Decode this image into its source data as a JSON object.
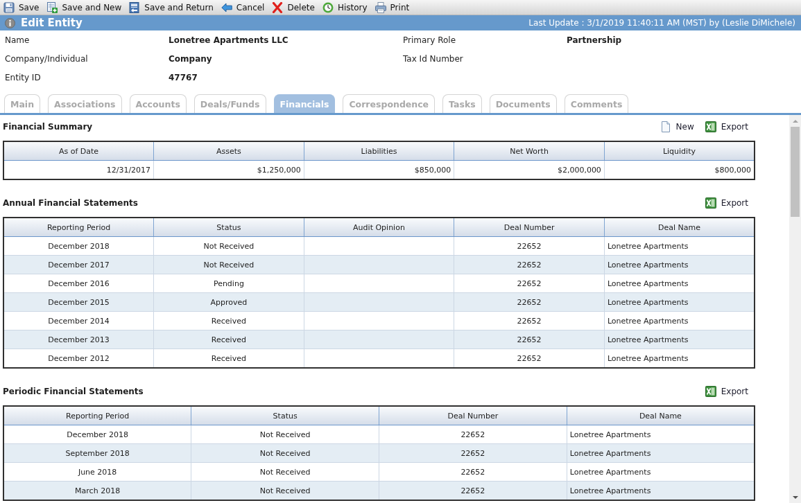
{
  "toolbar": [
    {
      "kind": "save",
      "label": "Save"
    },
    {
      "kind": "savenew",
      "label": "Save and New"
    },
    {
      "kind": "savereturn",
      "label": "Save and Return"
    },
    {
      "kind": "cancel",
      "label": "Cancel"
    },
    {
      "kind": "delete",
      "label": "Delete"
    },
    {
      "kind": "history",
      "label": "History"
    },
    {
      "kind": "print",
      "label": "Print"
    }
  ],
  "header": {
    "title": "Edit Entity",
    "last_update": "Last Update : 3/1/2019 11:40:11 AM (MST) by (Leslie DiMichele)"
  },
  "fields": [
    {
      "label": "Name",
      "value": "Lonetree Apartments LLC"
    },
    {
      "label": "Primary Role",
      "value": "Partnership"
    },
    {
      "label": "Company/Individual",
      "value": "Company"
    },
    {
      "label": "Tax Id Number"
    },
    {
      "label": "Entity ID",
      "value": "47767"
    }
  ],
  "tabs": [
    {
      "label": "Main",
      "selected": false
    },
    {
      "label": "Associations",
      "selected": false
    },
    {
      "label": "Accounts",
      "selected": false
    },
    {
      "label": "Deals/Funds",
      "selected": false
    },
    {
      "label": "Financials",
      "selected": true
    },
    {
      "label": "Correspondence",
      "selected": false
    },
    {
      "label": "Tasks",
      "selected": false
    },
    {
      "label": "Documents",
      "selected": false
    },
    {
      "label": "Comments",
      "selected": false
    }
  ],
  "sections": [
    {
      "kind": "summary",
      "title": "Financial Summary",
      "actions": [
        {
          "kind": "new",
          "label": "New"
        },
        {
          "kind": "export",
          "label": "Export"
        }
      ],
      "table": {
        "columns": [
          "As of Date",
          "Assets",
          "Liabilities",
          "Net Worth",
          "Liquidity"
        ],
        "rows": [
          [
            "12/31/2017",
            "$1,250,000",
            "$850,000",
            "$2,000,000",
            "$800,000"
          ]
        ]
      }
    },
    {
      "kind": "list",
      "title": "Annual Financial Statements",
      "actions": [
        {
          "kind": "export",
          "label": "Export"
        }
      ],
      "table": {
        "columns": [
          "Reporting Period",
          "Status",
          "Audit Opinion",
          "Deal Number",
          "Deal Name"
        ],
        "rows": [
          [
            "December 2018",
            "Not Received",
            null,
            "22652",
            "Lonetree Apartments"
          ],
          [
            "December 2017",
            "Not Received",
            null,
            "22652",
            "Lonetree Apartments"
          ],
          [
            "December 2016",
            "Pending",
            null,
            "22652",
            "Lonetree Apartments"
          ],
          [
            "December 2015",
            "Approved",
            null,
            "22652",
            "Lonetree Apartments"
          ],
          [
            "December 2014",
            "Received",
            null,
            "22652",
            "Lonetree Apartments"
          ],
          [
            "December 2013",
            "Received",
            null,
            "22652",
            "Lonetree Apartments"
          ],
          [
            "December 2012",
            "Received",
            null,
            "22652",
            "Lonetree Apartments"
          ]
        ]
      }
    },
    {
      "kind": "list",
      "title": "Periodic Financial Statements",
      "actions": [
        {
          "kind": "export",
          "label": "Export"
        }
      ],
      "table": {
        "columns": [
          "Reporting Period",
          "Status",
          "Deal Number",
          "Deal Name"
        ],
        "rows": [
          [
            "December 2018",
            "Not Received",
            "22652",
            "Lonetree Apartments"
          ],
          [
            "September 2018",
            "Not Received",
            "22652",
            "Lonetree Apartments"
          ],
          [
            "June 2018",
            "Not Received",
            "22652",
            "Lonetree Apartments"
          ],
          [
            "March 2018",
            "Not Received",
            "22652",
            "Lonetree Apartments"
          ]
        ]
      }
    }
  ]
}
